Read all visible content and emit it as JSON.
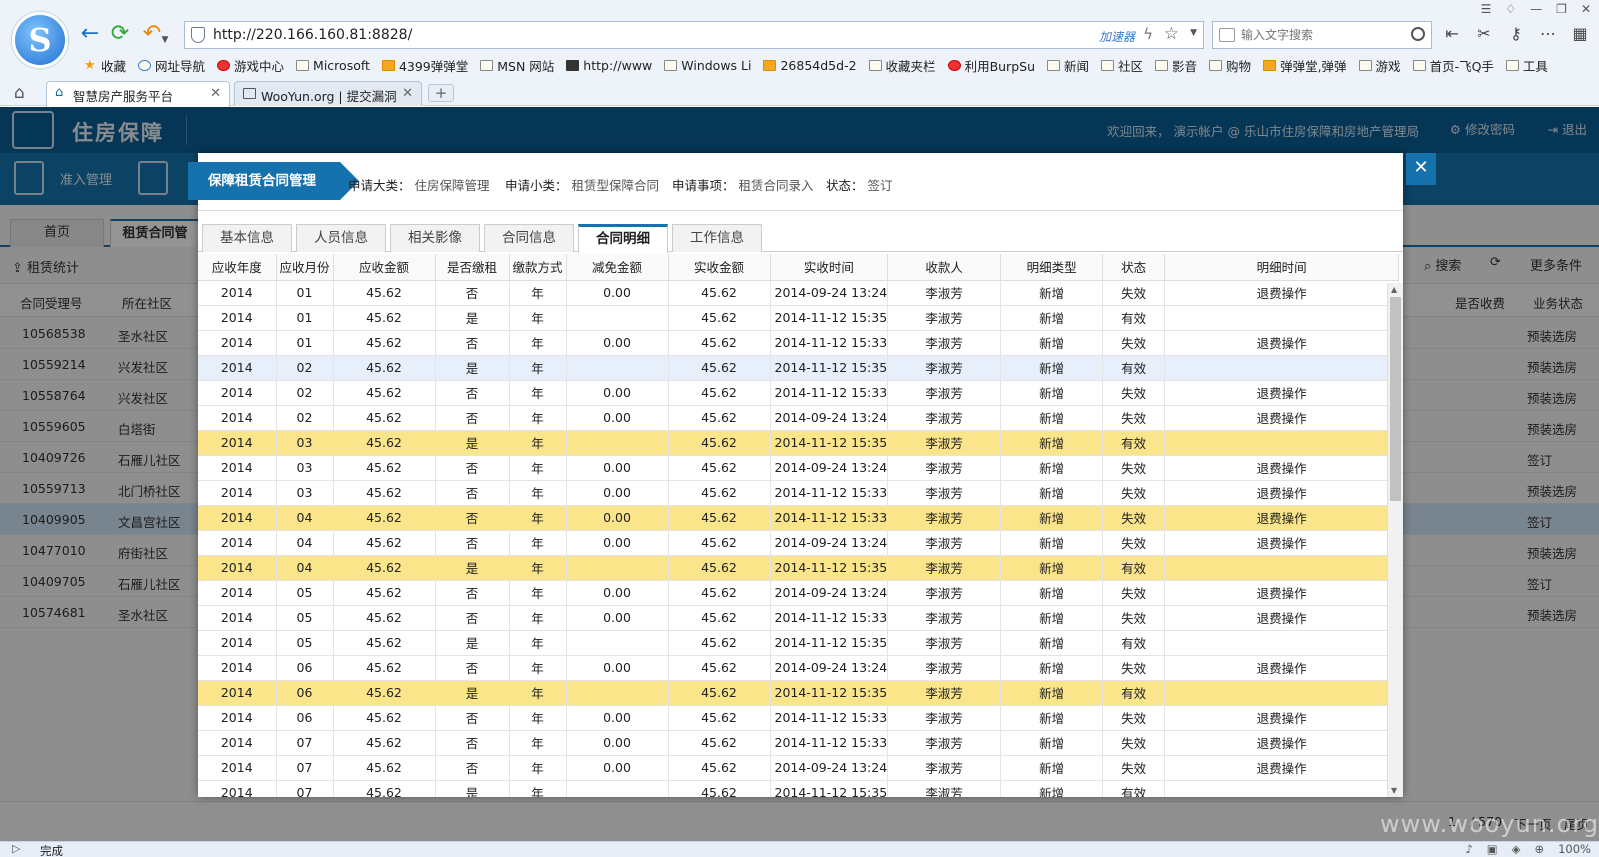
{
  "browser": {
    "url": "http://220.166.160.81:8828/",
    "accelerator_label": "加速器",
    "search_placeholder": "输入文字搜索",
    "bookmarks": [
      "收藏",
      "网址导航",
      "游戏中心",
      "Microsoft",
      "4399弹弹堂",
      "MSN 网站",
      "http://www",
      "Windows Li",
      "26854d5d-2",
      "收藏夹栏",
      "利用BurpSu",
      "新闻",
      "社区",
      "影音",
      "购物",
      "弹弹堂,弹弹",
      "游戏",
      "首页-飞Q手",
      "工具"
    ],
    "tabs": [
      {
        "label": "智慧房产服务平台",
        "active": true
      },
      {
        "label": "WooYun.org | 提交漏洞",
        "active": false
      }
    ],
    "status": "完成",
    "zoom": "100%"
  },
  "app": {
    "title": "住房保障",
    "welcome": "欢迎回来， 演示帐户 @ 乐山市住房保障和房地产管理局",
    "change_password": "修改密码",
    "logout": "退出",
    "nav": [
      "准入管理"
    ],
    "tabs": [
      "首页",
      "租赁合同管"
    ],
    "toolbar": {
      "stats": "租赁统计",
      "search": "搜索",
      "more": "更多条件"
    },
    "columns": {
      "id": "合同受理号",
      "community": "所在社区",
      "is_charged": "是否收费",
      "status": "业务状态"
    },
    "rows": [
      {
        "id": "10568538",
        "community": "圣水社区",
        "status": "预装选房"
      },
      {
        "id": "10559214",
        "community": "兴发社区",
        "status": "预装选房"
      },
      {
        "id": "10558764",
        "community": "兴发社区",
        "status": "预装选房"
      },
      {
        "id": "10559605",
        "community": "白塔街",
        "status": "预装选房"
      },
      {
        "id": "10409726",
        "community": "石雁儿社区",
        "status": "签订"
      },
      {
        "id": "10559713",
        "community": "北门桥社区",
        "status": "预装选房"
      },
      {
        "id": "10409905",
        "community": "文昌宫社区",
        "status": "签订"
      },
      {
        "id": "10477010",
        "community": "府街社区",
        "status": "预装选房"
      },
      {
        "id": "10409705",
        "community": "石雁儿社区",
        "status": "签订"
      },
      {
        "id": "10574681",
        "community": "圣水社区",
        "status": "预装选房"
      }
    ],
    "pager": {
      "page": "1",
      "total": "/ 570",
      "next": "下一页",
      "last": "尾页"
    }
  },
  "modal": {
    "title": "保障租赁合同管理",
    "meta": [
      {
        "label": "申请大类：",
        "value": "住房保障管理"
      },
      {
        "label": "申请小类：",
        "value": "租赁型保障合同"
      },
      {
        "label": "申请事项：",
        "value": "租赁合同录入"
      },
      {
        "label": "状态：",
        "value": "签订"
      }
    ],
    "tabs": [
      "基本信息",
      "人员信息",
      "相关影像",
      "合同信息",
      "合同明细",
      "工作信息"
    ],
    "active_tab": 4,
    "columns": [
      "应收年度",
      "应收月份",
      "应收金额",
      "是否缴租",
      "缴款方式",
      "减免金额",
      "实收金额",
      "实收时间",
      "收款人",
      "明细类型",
      "状态",
      "明细时间"
    ],
    "rows": [
      [
        "2014",
        "01",
        "45.62",
        "否",
        "年",
        "0.00",
        "45.62",
        "2014-09-24 13:24",
        "李淑芳",
        "新增",
        "失效",
        "退费操作",
        "white"
      ],
      [
        "2014",
        "01",
        "45.62",
        "是",
        "年",
        "",
        "45.62",
        "2014-11-12 15:35",
        "李淑芳",
        "新增",
        "有效",
        "",
        "white"
      ],
      [
        "2014",
        "01",
        "45.62",
        "否",
        "年",
        "0.00",
        "45.62",
        "2014-11-12 15:33",
        "李淑芳",
        "新增",
        "失效",
        "退费操作",
        "white"
      ],
      [
        "2014",
        "02",
        "45.62",
        "是",
        "年",
        "",
        "45.62",
        "2014-11-12 15:35",
        "李淑芳",
        "新增",
        "有效",
        "",
        "blue"
      ],
      [
        "2014",
        "02",
        "45.62",
        "否",
        "年",
        "0.00",
        "45.62",
        "2014-11-12 15:33",
        "李淑芳",
        "新增",
        "失效",
        "退费操作",
        "white"
      ],
      [
        "2014",
        "02",
        "45.62",
        "否",
        "年",
        "0.00",
        "45.62",
        "2014-09-24 13:24",
        "李淑芳",
        "新增",
        "失效",
        "退费操作",
        "white"
      ],
      [
        "2014",
        "03",
        "45.62",
        "是",
        "年",
        "",
        "45.62",
        "2014-11-12 15:35",
        "李淑芳",
        "新增",
        "有效",
        "",
        "yellow"
      ],
      [
        "2014",
        "03",
        "45.62",
        "否",
        "年",
        "0.00",
        "45.62",
        "2014-09-24 13:24",
        "李淑芳",
        "新增",
        "失效",
        "退费操作",
        "white"
      ],
      [
        "2014",
        "03",
        "45.62",
        "否",
        "年",
        "0.00",
        "45.62",
        "2014-11-12 15:33",
        "李淑芳",
        "新增",
        "失效",
        "退费操作",
        "white"
      ],
      [
        "2014",
        "04",
        "45.62",
        "否",
        "年",
        "0.00",
        "45.62",
        "2014-11-12 15:33",
        "李淑芳",
        "新增",
        "失效",
        "退费操作",
        "yellow"
      ],
      [
        "2014",
        "04",
        "45.62",
        "否",
        "年",
        "0.00",
        "45.62",
        "2014-09-24 13:24",
        "李淑芳",
        "新增",
        "失效",
        "退费操作",
        "white"
      ],
      [
        "2014",
        "04",
        "45.62",
        "是",
        "年",
        "",
        "45.62",
        "2014-11-12 15:35",
        "李淑芳",
        "新增",
        "有效",
        "",
        "yellow"
      ],
      [
        "2014",
        "05",
        "45.62",
        "否",
        "年",
        "0.00",
        "45.62",
        "2014-09-24 13:24",
        "李淑芳",
        "新增",
        "失效",
        "退费操作",
        "white"
      ],
      [
        "2014",
        "05",
        "45.62",
        "否",
        "年",
        "0.00",
        "45.62",
        "2014-11-12 15:33",
        "李淑芳",
        "新增",
        "失效",
        "退费操作",
        "white"
      ],
      [
        "2014",
        "05",
        "45.62",
        "是",
        "年",
        "",
        "45.62",
        "2014-11-12 15:35",
        "李淑芳",
        "新增",
        "有效",
        "",
        "white"
      ],
      [
        "2014",
        "06",
        "45.62",
        "否",
        "年",
        "0.00",
        "45.62",
        "2014-09-24 13:24",
        "李淑芳",
        "新增",
        "失效",
        "退费操作",
        "white"
      ],
      [
        "2014",
        "06",
        "45.62",
        "是",
        "年",
        "",
        "45.62",
        "2014-11-12 15:35",
        "李淑芳",
        "新增",
        "有效",
        "",
        "yellow"
      ],
      [
        "2014",
        "06",
        "45.62",
        "否",
        "年",
        "0.00",
        "45.62",
        "2014-11-12 15:33",
        "李淑芳",
        "新增",
        "失效",
        "退费操作",
        "white"
      ],
      [
        "2014",
        "07",
        "45.62",
        "否",
        "年",
        "0.00",
        "45.62",
        "2014-11-12 15:33",
        "李淑芳",
        "新增",
        "失效",
        "退费操作",
        "white"
      ],
      [
        "2014",
        "07",
        "45.62",
        "否",
        "年",
        "0.00",
        "45.62",
        "2014-09-24 13:24",
        "李淑芳",
        "新增",
        "失效",
        "退费操作",
        "white"
      ],
      [
        "2014",
        "07",
        "45.62",
        "是",
        "年",
        "",
        "45.62",
        "2014-11-12 15:35",
        "李淑芳",
        "新增",
        "有效",
        "",
        "white"
      ]
    ]
  },
  "watermark": "www.wooyun.org",
  "colors": {
    "brand_dark": "#0c5e93",
    "brand": "#1672ad",
    "highlight": "#fbe58a",
    "row_selected": "#e7f0fa"
  }
}
